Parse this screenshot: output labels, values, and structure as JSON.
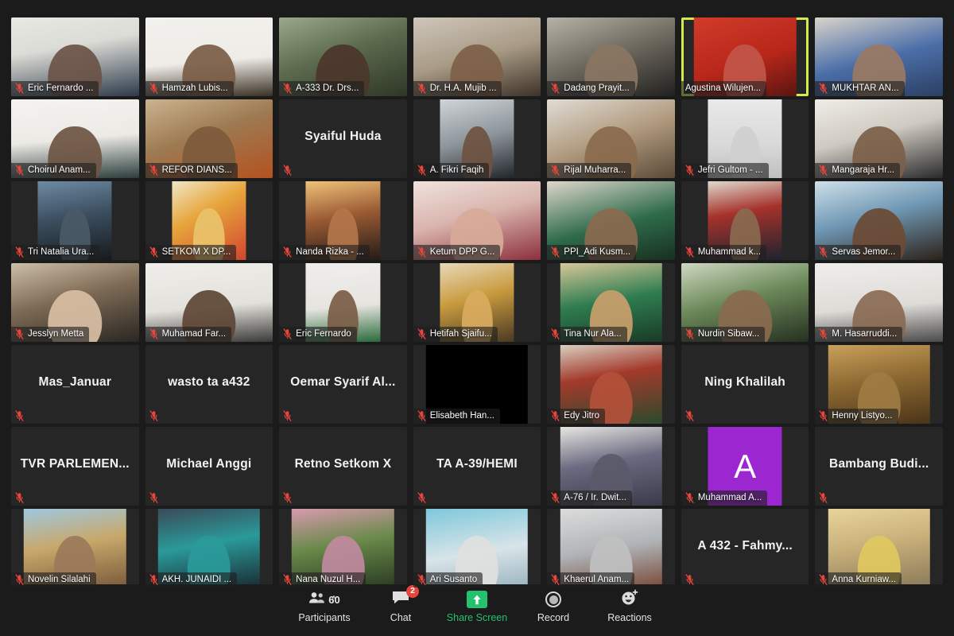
{
  "app": {
    "name": "Zoom Meeting",
    "view": "Gallery View"
  },
  "gallery": {
    "columns": 7,
    "rows": 7,
    "active_speaker": "Agustina Wilujen...",
    "tiles": [
      {
        "name": "Eric Fernardo ...",
        "type": "video",
        "muted": true,
        "video": "wide",
        "bg": "linear-gradient(170deg,#e8e8e4 0%,#dcdcd6 38%,#2d3a4a 100%)",
        "skin": "#6b5347"
      },
      {
        "name": "Hamzah Lubis...",
        "type": "video",
        "muted": true,
        "video": "wide",
        "bg": "linear-gradient(175deg,#f3f1ee 0%,#efece7 55%,#3a3024 100%)",
        "skin": "#7a5c45"
      },
      {
        "name": "A-333 Dr. Drs...",
        "type": "video",
        "muted": true,
        "video": "wide",
        "bg": "linear-gradient(160deg,#9aa88b 0%,#5d6b4f 45%,#2e3726 100%)",
        "skin": "#4a362a"
      },
      {
        "name": "Dr. H.A. Mujib ...",
        "type": "video",
        "muted": true,
        "video": "wide",
        "bg": "linear-gradient(165deg,#cfc7bb 0%,#a89a85 50%,#3c3228 100%)",
        "skin": "#7d6048"
      },
      {
        "name": "Dadang Prayit...",
        "type": "video",
        "muted": true,
        "video": "wide",
        "bg": "linear-gradient(160deg,#b7b2a8 0%,#6f6a60 48%,#20201e 100%)",
        "skin": "#8a7663"
      },
      {
        "name": "Agustina Wilujen...",
        "type": "video",
        "muted": false,
        "active": true,
        "video": "mid",
        "bg": "linear-gradient(160deg,#d13b2a 0%,#b8271a 55%,#5a1510 100%)",
        "skin": "#c2564a"
      },
      {
        "name": "MUKHTAR AN...",
        "type": "video",
        "muted": true,
        "video": "wide",
        "bg": "linear-gradient(165deg,#d9d4cb 0%,#4b6ea8 52%,#2b3f63 100%)",
        "skin": "#9a7a63"
      },
      {
        "name": "Choirul Anam...",
        "type": "video",
        "muted": true,
        "video": "wide",
        "bg": "linear-gradient(175deg,#f5f3f0 0%,#eceae5 50%,#2b3d3a 100%)",
        "skin": "#6d5442"
      },
      {
        "name": "REFOR DIANS...",
        "type": "video",
        "muted": true,
        "video": "wide",
        "bg": "linear-gradient(160deg,#cbb48f 0%,#9d7a52 45%,#b5511f 100%)",
        "skin": "#7d5a3c"
      },
      {
        "name": "Syaiful Huda",
        "type": "name",
        "muted": true
      },
      {
        "name": "A. Fikri Faqih",
        "type": "video",
        "muted": true,
        "video": "portrait",
        "bg": "linear-gradient(165deg,#cfd5d8 0%,#8d949a 50%,#22262b 100%)",
        "skin": "#6e5340"
      },
      {
        "name": "Rijal Muharra...",
        "type": "video",
        "muted": true,
        "video": "wide",
        "bg": "linear-gradient(160deg,#e0dcd4 0%,#b09a7e 50%,#5b4a38 100%)",
        "skin": "#8a6a4c"
      },
      {
        "name": "Jefri Gultom - ...",
        "type": "video",
        "muted": true,
        "video": "portrait",
        "bg": "linear-gradient(180deg,#e9e9e9 0%,#d8d8d8 60%,#bfbfbf 100%)",
        "skin": "#cfcfcf"
      },
      {
        "name": "Mangaraja Hr...",
        "type": "video",
        "muted": true,
        "video": "wide",
        "bg": "linear-gradient(165deg,#efede8 0%,#cfcac1 45%,#2a2a2c 100%)",
        "skin": "#7c6049"
      },
      {
        "name": "Tri Natalia Ura...",
        "type": "video",
        "muted": true,
        "video": "portrait",
        "bg": "linear-gradient(170deg,#6d8aa3 0%,#3c4f60 45%,#171a1d 100%)",
        "skin": "#4a5a66"
      },
      {
        "name": "SETKOM X DP...",
        "type": "video",
        "muted": true,
        "video": "portrait",
        "bg": "linear-gradient(150deg,#f0e6c8 0%,#e7a63c 40%,#d2452f 100%)",
        "skin": "#e8c36a"
      },
      {
        "name": "Nanda Rizka - ...",
        "type": "video",
        "muted": true,
        "video": "portrait",
        "bg": "linear-gradient(170deg,#efc27a 0%,#9a5a33 45%,#241b18 100%)",
        "skin": "#b3764a"
      },
      {
        "name": "Ketum DPP G...",
        "type": "video",
        "muted": true,
        "video": "wide",
        "bg": "linear-gradient(165deg,#f0e2dd 0%,#d9b4ad 45%,#8c2f3c 100%)",
        "skin": "#d8aa98"
      },
      {
        "name": "PPI_Adi Kusm...",
        "type": "video",
        "muted": true,
        "video": "wide",
        "bg": "linear-gradient(165deg,#ded7cb 0%,#2f6b4b 55%,#17301f 100%)",
        "skin": "#8b6a4e"
      },
      {
        "name": "Muhammad k...",
        "type": "video",
        "muted": true,
        "video": "portrait",
        "bg": "linear-gradient(170deg,#dfd9cf 0%,#a5322a 40%,#1d2430 100%)",
        "skin": "#8a6a50"
      },
      {
        "name": "Servas Jemor...",
        "type": "video",
        "muted": true,
        "video": "wide",
        "bg": "linear-gradient(165deg,#cfe0ea 0%,#6f97b3 45%,#2b2118 100%)",
        "skin": "#6b4a34"
      },
      {
        "name": "Jesslyn Metta",
        "type": "video",
        "muted": true,
        "video": "wide",
        "bg": "linear-gradient(165deg,#cdbfa8 0%,#7d6a55 45%,#2a2723 100%)",
        "skin": "#d9bfa4"
      },
      {
        "name": "Muhamad Far...",
        "type": "video",
        "muted": true,
        "video": "wide",
        "bg": "linear-gradient(175deg,#efeeea 0%,#e3e1dc 55%,#3a3a38 100%)",
        "skin": "#5d4534"
      },
      {
        "name": "Eric Fernardo",
        "type": "video",
        "muted": true,
        "video": "portrait",
        "bg": "linear-gradient(175deg,#f0efec 0%,#e6e4df 55%,#2b6b3c 100%)",
        "skin": "#7a5c45"
      },
      {
        "name": "Hetifah Sjaifu...",
        "type": "video",
        "muted": true,
        "video": "portrait",
        "bg": "linear-gradient(165deg,#e8d9b8 0%,#c89a3e 45%,#4a3a22 100%)",
        "skin": "#d9ab5e"
      },
      {
        "name": "Tina Nur Ala...",
        "type": "video",
        "muted": true,
        "video": "mid",
        "bg": "linear-gradient(170deg,#d8c79a 0%,#2e7d4f 48%,#1a3a28 100%)",
        "skin": "#caa06c"
      },
      {
        "name": "Nurdin Sibaw...",
        "type": "video",
        "muted": true,
        "video": "wide",
        "bg": "linear-gradient(165deg,#cfd8c2 0%,#6d8a5a 45%,#243020 100%)",
        "skin": "#8a6a4e"
      },
      {
        "name": "M. Hasarruddi...",
        "type": "video",
        "muted": true,
        "video": "wide",
        "bg": "linear-gradient(175deg,#efeeeb 0%,#dedcd7 55%,#4a4a4a 100%)",
        "skin": "#8a6a52"
      },
      {
        "name": "Mas_Januar",
        "type": "name",
        "muted": true
      },
      {
        "name": "wasto ta a432",
        "type": "name",
        "muted": true
      },
      {
        "name": "Oemar Syarif Al...",
        "type": "name",
        "muted": true
      },
      {
        "name": "Elisabeth Han...",
        "type": "video",
        "muted": true,
        "video": "mid",
        "bg": "#000000",
        "skin": "#000000"
      },
      {
        "name": "Edy Jitro",
        "type": "video",
        "muted": true,
        "video": "mid",
        "bg": "linear-gradient(170deg,#d8cfc0 0%,#a33a2c 40%,#2c4a2c 100%)",
        "skin": "#b4503a"
      },
      {
        "name": "Ning Khalilah",
        "type": "name",
        "muted": true
      },
      {
        "name": "Henny Listyo...",
        "type": "video",
        "muted": true,
        "video": "mid",
        "bg": "linear-gradient(170deg,#c9a05a 0%,#8e6a33 45%,#4a3418 100%)",
        "skin": "#a07c42"
      },
      {
        "name": "TVR PARLEMEN...",
        "type": "name",
        "muted": true
      },
      {
        "name": "Michael Anggi",
        "type": "name",
        "muted": true
      },
      {
        "name": "Retno Setkom X",
        "type": "name",
        "muted": true
      },
      {
        "name": "TA A-39/HEMI",
        "type": "name",
        "muted": true
      },
      {
        "name": "A-76 / Ir. Dwit...",
        "type": "video",
        "muted": true,
        "video": "mid",
        "bg": "linear-gradient(170deg,#e8e6e2 0%,#6a6a80 45%,#3a3a4a 100%)",
        "skin": "#5a5a6a"
      },
      {
        "name": "Muhammad A...",
        "type": "letter",
        "letter": "A",
        "muted": true,
        "bg": "#9c27d0"
      },
      {
        "name": "Bambang Budi...",
        "type": "name",
        "muted": true
      },
      {
        "name": "Novelin Silalahi",
        "type": "video",
        "muted": true,
        "video": "mid",
        "bg": "linear-gradient(170deg,#9ec8e0 0%,#c8a86a 45%,#7a5a3a 100%)",
        "skin": "#9a7a5a"
      },
      {
        "name": "AKH. JUNAIDI ...",
        "type": "video",
        "muted": true,
        "video": "mid",
        "bg": "linear-gradient(170deg,#3a4a58 0%,#2a9a9a 45%,#1a2a33 100%)",
        "skin": "#2a9a9a"
      },
      {
        "name": "Nana Nuzul H...",
        "type": "video",
        "muted": true,
        "video": "mid",
        "bg": "linear-gradient(170deg,#d89ab0 0%,#6a8a4a 45%,#2a3a22 100%)",
        "skin": "#c08aa0"
      },
      {
        "name": "Ari Susanto",
        "type": "video",
        "muted": true,
        "video": "mid",
        "bg": "linear-gradient(170deg,#7ec8dc 0%,#d8e4e8 55%,#9ab4c0 100%)",
        "skin": "#e0e0e0"
      },
      {
        "name": "Khaerul Anam...",
        "type": "video",
        "muted": true,
        "video": "mid",
        "bg": "linear-gradient(170deg,#dcdcdc 0%,#b0b4b8 50%,#7a4a3a 100%)",
        "skin": "#c0c0c0"
      },
      {
        "name": "A 432 - Fahmy...",
        "type": "name",
        "muted": true
      },
      {
        "name": "Anna Kurniaw...",
        "type": "video",
        "muted": true,
        "video": "mid",
        "bg": "linear-gradient(170deg,#e8d49a 0%,#c8b07a 45%,#8a7a5a 100%)",
        "skin": "#e0c860"
      }
    ]
  },
  "toolbar": {
    "items": [
      {
        "label": "Participants",
        "icon": "participants-icon",
        "count": "60",
        "caret": "∧"
      },
      {
        "label": "Chat",
        "icon": "chat-icon",
        "badge": "2"
      },
      {
        "label": "Share Screen",
        "icon": "share-screen-icon",
        "accent": "#25c16f"
      },
      {
        "label": "Record",
        "icon": "record-icon"
      },
      {
        "label": "Reactions",
        "icon": "reactions-icon"
      }
    ]
  },
  "colors": {
    "active_border": "#d6e94a",
    "share_green": "#25c16f",
    "badge_red": "#e8453c",
    "mute_red": "#e8453c",
    "tile_bg": "#262626",
    "app_bg": "#1b1b1b"
  }
}
